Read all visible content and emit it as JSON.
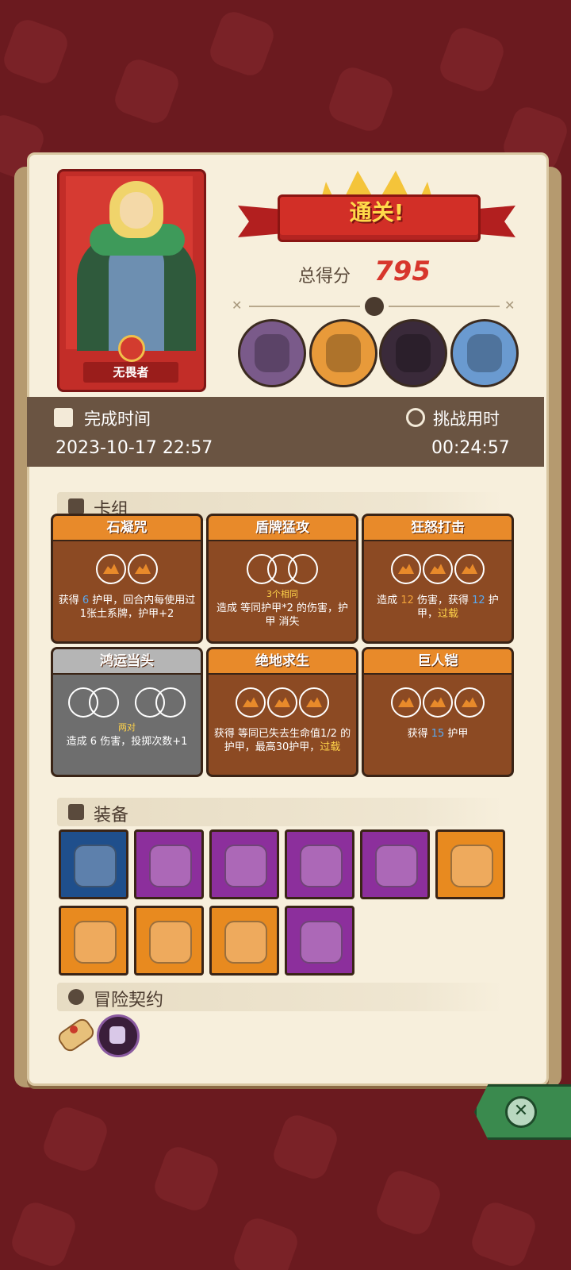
{
  "hero": {
    "name": "无畏者"
  },
  "result": {
    "banner": "通关!",
    "score_label": "总得分",
    "score": "795"
  },
  "stats": {
    "finish_label": "完成时间",
    "finish_value": "2023-10-17 22:57",
    "duration_label": "挑战用时",
    "duration_value": "00:24:57"
  },
  "sections": {
    "deck": "卡组",
    "equipment": "装备",
    "contract": "冒险契约"
  },
  "cards": [
    {
      "name": "石凝咒",
      "style": "orange",
      "dice": 2,
      "sub": "",
      "desc_parts": [
        "获得 ",
        "6",
        " 护甲，回合内每使用过1张",
        "土系牌，",
        "护甲+2"
      ]
    },
    {
      "name": "盾牌猛攻",
      "style": "orange",
      "dice": 3,
      "sub": "3个相同",
      "desc_parts": [
        "造成 等同",
        "护甲*2 的伤害，",
        "护甲 消失"
      ]
    },
    {
      "name": "狂怒打击",
      "style": "orange",
      "dice": 3,
      "sub": "",
      "desc_parts": [
        "造成 ",
        "12",
        " 伤害，获得 ",
        "12",
        " 护甲，",
        "过载"
      ]
    },
    {
      "name": "鸿运当头",
      "style": "gray",
      "dice": 4,
      "sub": "两对",
      "desc_parts": [
        "造成 ",
        "6",
        " 伤害，投掷次数+1"
      ]
    },
    {
      "name": "绝地求生",
      "style": "orange",
      "dice": 3,
      "sub": "",
      "desc_parts": [
        "获得 等同已失去",
        "生命值1/2 的护甲，最高30护甲，",
        "过载"
      ]
    },
    {
      "name": "巨人铠",
      "style": "orange",
      "dice": 3,
      "sub": "",
      "desc_parts": [
        "获得 ",
        "15",
        " 护甲"
      ]
    }
  ],
  "equipment": [
    {
      "icon": "gold-crown-helmet-icon",
      "bg": "#1f4f8c"
    },
    {
      "icon": "pink-slime-cube-icon",
      "bg": "#8c2f9c"
    },
    {
      "icon": "blue-demon-mask-icon",
      "bg": "#8c2f9c"
    },
    {
      "icon": "cracked-dark-rune-icon",
      "bg": "#8c2f9c"
    },
    {
      "icon": "fang-claws-icon",
      "bg": "#8c2f9c"
    },
    {
      "icon": "jeweled-shield-icon",
      "bg": "#e88a1f"
    },
    {
      "icon": "mossy-stone-slab-icon",
      "bg": "#e88a1f"
    },
    {
      "icon": "golden-round-shield-icon",
      "bg": "#e88a1f"
    },
    {
      "icon": "orange-dice-icon",
      "bg": "#e88a1f"
    },
    {
      "icon": "emerald-gold-ring-icon",
      "bg": "#8c2f9c"
    }
  ],
  "contract": [
    {
      "icon": "scroll-icon"
    },
    {
      "icon": "purple-fist-badge-icon"
    }
  ],
  "bosses": [
    {
      "icon": "pink-golem-boss-icon",
      "bg": "#7a5a8a"
    },
    {
      "icon": "horned-bull-boss-icon",
      "bg": "#e89a3a"
    },
    {
      "icon": "dark-knight-boss-icon",
      "bg": "#3a2a3a"
    },
    {
      "icon": "bone-dragon-boss-icon",
      "bg": "#6a9ad0"
    }
  ]
}
